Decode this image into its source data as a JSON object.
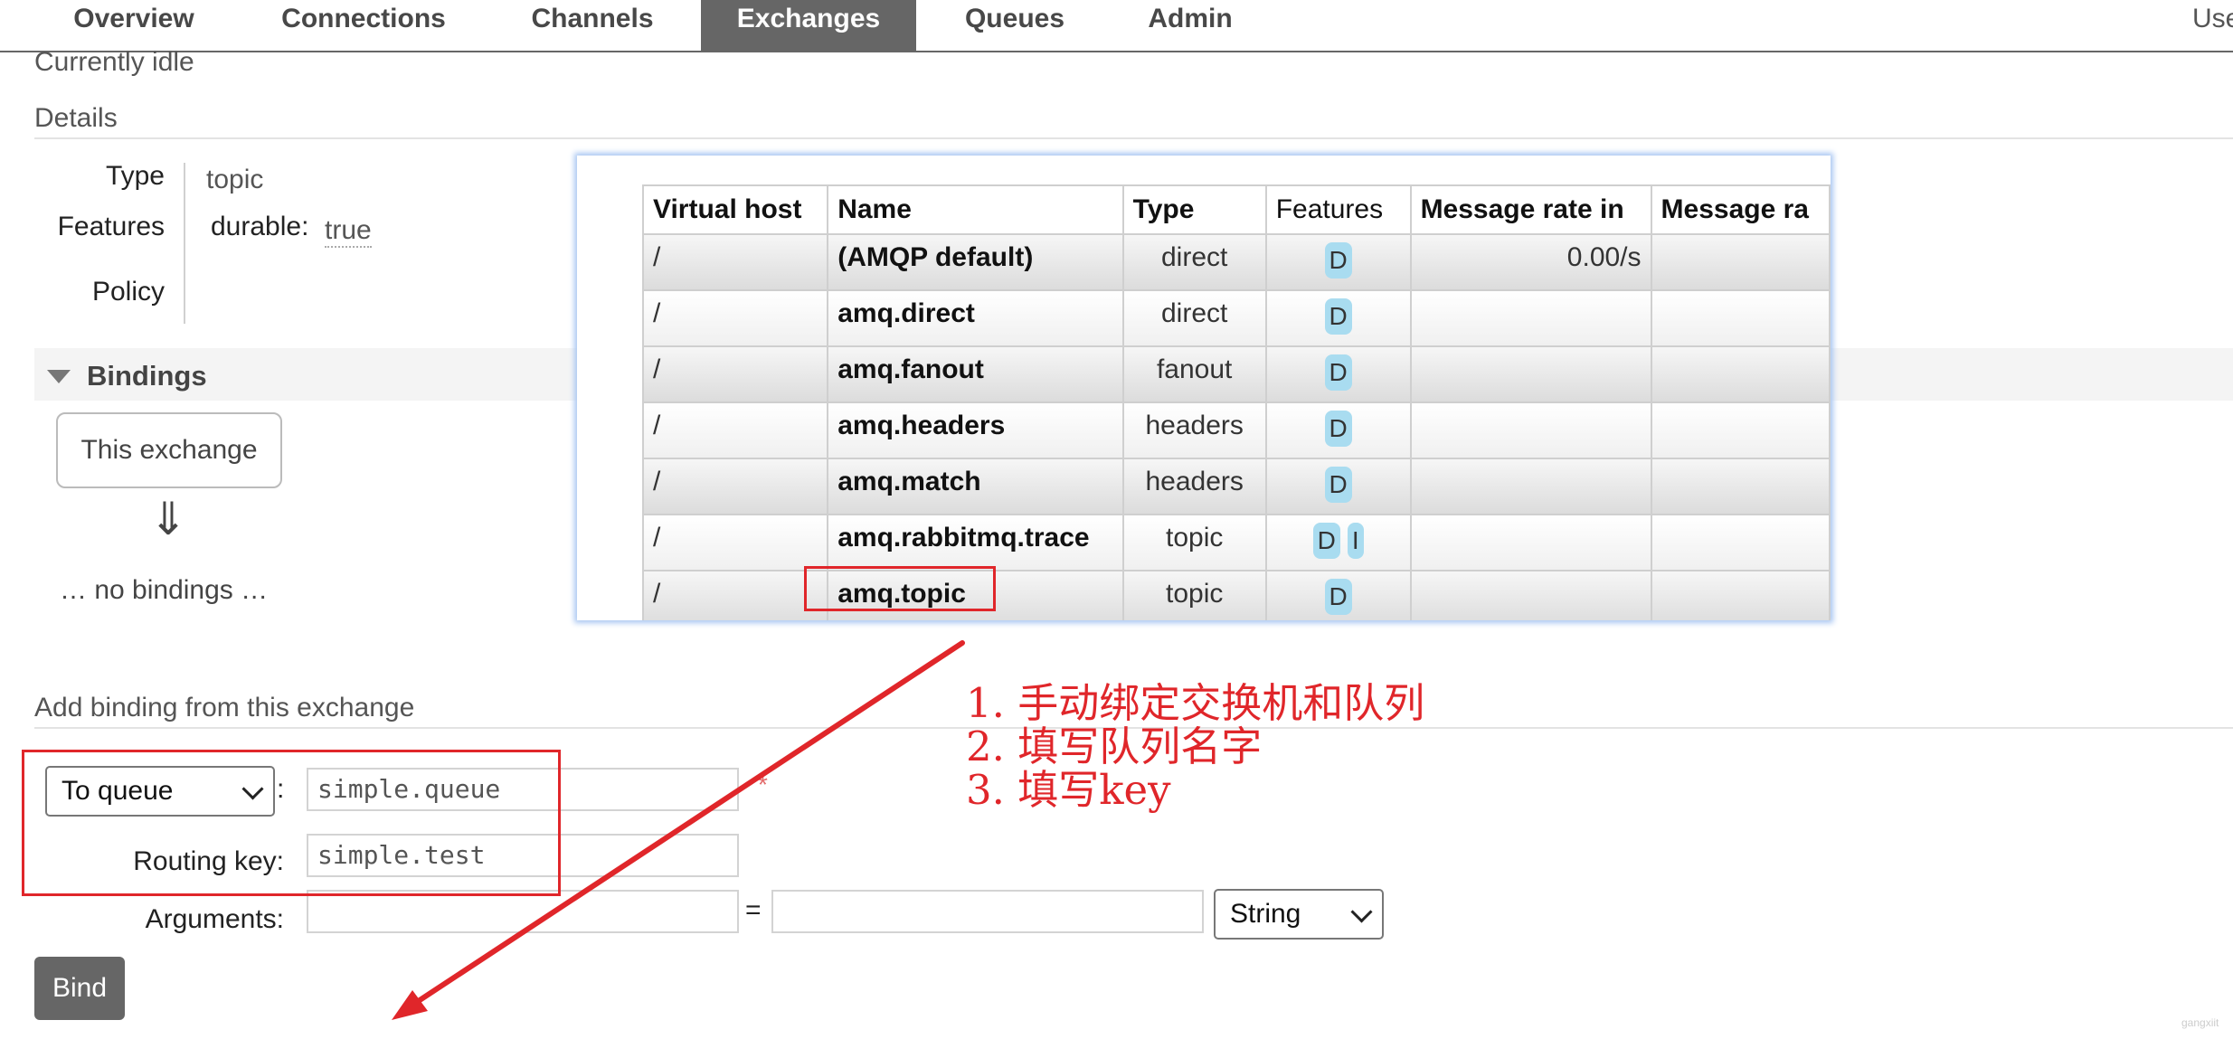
{
  "nav": {
    "items": [
      {
        "label": "Overview",
        "active": false
      },
      {
        "label": "Connections",
        "active": false
      },
      {
        "label": "Channels",
        "active": false
      },
      {
        "label": "Exchanges",
        "active": true
      },
      {
        "label": "Queues",
        "active": false
      },
      {
        "label": "Admin",
        "active": false
      }
    ],
    "user_partial": "Use"
  },
  "status_text": "Currently idle",
  "details": {
    "heading": "Details",
    "type_label": "Type",
    "type_value": "topic",
    "features_label": "Features",
    "durable_label": "durable:",
    "durable_value": "true",
    "policy_label": "Policy"
  },
  "bindings": {
    "heading": "Bindings",
    "this_exchange": "This exchange",
    "arrow": "⇓",
    "no_bindings": "… no bindings …"
  },
  "add_binding": {
    "heading": "Add binding from this exchange",
    "destination_select": "To queue",
    "queue_value": "simple.queue",
    "routing_key_label": "Routing key:",
    "routing_key_value": "simple.test",
    "arguments_label": "Arguments:",
    "equals": "=",
    "arg_type_select": "String",
    "colon": ":",
    "required_mark": "*",
    "bind_button": "Bind"
  },
  "exchanges_table": {
    "columns": [
      "Virtual host",
      "Name",
      "Type",
      "Features",
      "Message rate in",
      "Message ra"
    ],
    "rows": [
      {
        "vhost": "/",
        "name": "(AMQP default)",
        "type": "direct",
        "features": [
          "D"
        ],
        "rate_in": "0.00/s",
        "rate_out": ""
      },
      {
        "vhost": "/",
        "name": "amq.direct",
        "type": "direct",
        "features": [
          "D"
        ],
        "rate_in": "",
        "rate_out": ""
      },
      {
        "vhost": "/",
        "name": "amq.fanout",
        "type": "fanout",
        "features": [
          "D"
        ],
        "rate_in": "",
        "rate_out": ""
      },
      {
        "vhost": "/",
        "name": "amq.headers",
        "type": "headers",
        "features": [
          "D"
        ],
        "rate_in": "",
        "rate_out": ""
      },
      {
        "vhost": "/",
        "name": "amq.match",
        "type": "headers",
        "features": [
          "D"
        ],
        "rate_in": "",
        "rate_out": ""
      },
      {
        "vhost": "/",
        "name": "amq.rabbitmq.trace",
        "type": "topic",
        "features": [
          "D",
          "I"
        ],
        "rate_in": "",
        "rate_out": ""
      },
      {
        "vhost": "/",
        "name": "amq.topic",
        "type": "topic",
        "features": [
          "D"
        ],
        "rate_in": "",
        "rate_out": ""
      }
    ]
  },
  "annotation": {
    "lines": [
      "1. 手动绑定交换机和队列",
      "2. 填写队列名字",
      "3. 填写key"
    ],
    "color": "#e0262a"
  },
  "watermark": "gangxiit"
}
